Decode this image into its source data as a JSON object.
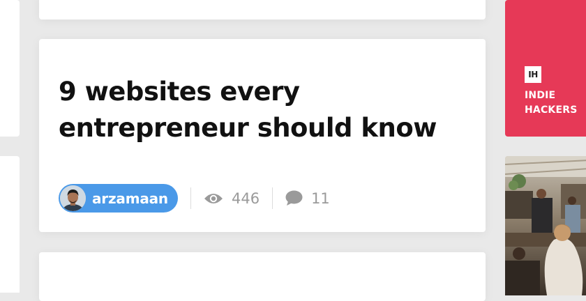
{
  "article": {
    "title": "9 websites every entrepreneur should know",
    "author": "arzamaan",
    "views": "446",
    "comments": "11"
  },
  "sidebar": {
    "logo_text": "IH",
    "brand_line1": "INDIE",
    "brand_line2": "HACKERS",
    "brand_color": "#e63957"
  },
  "colors": {
    "author_pill": "#4a99e8",
    "stat_text": "#9a9a9a",
    "title_text": "#111111"
  },
  "icons": [
    "eye-icon",
    "comment-icon",
    "avatar"
  ]
}
